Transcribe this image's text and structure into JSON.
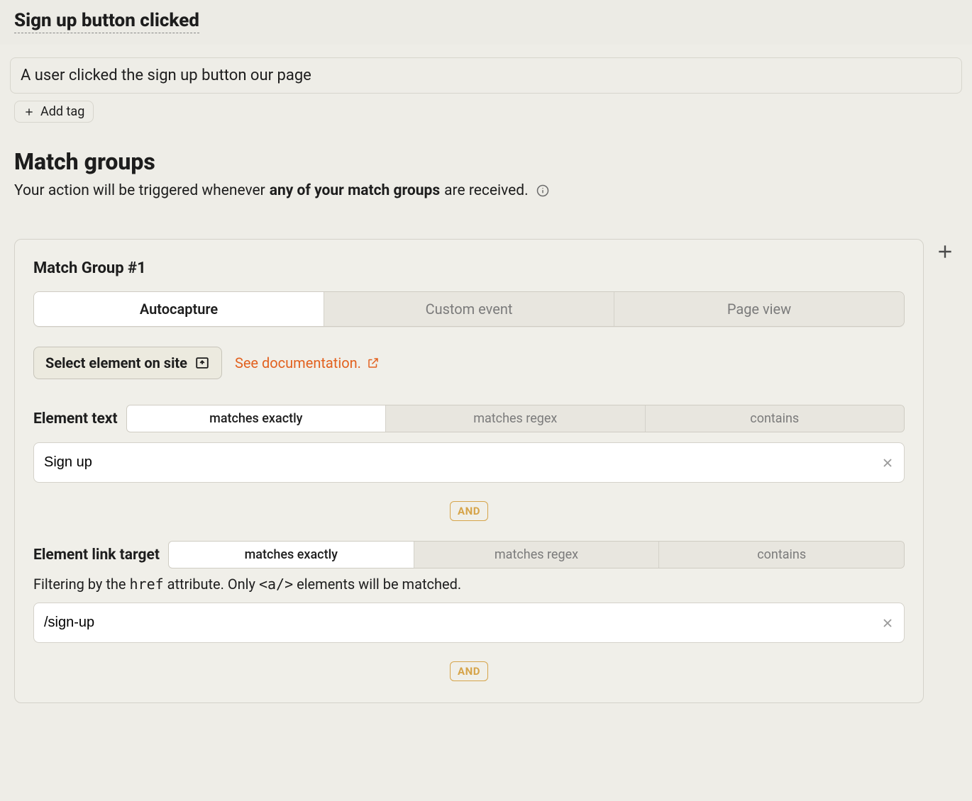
{
  "header": {
    "title": "Sign up button clicked"
  },
  "description": "A user clicked the sign up button our page",
  "tag_button": "Add tag",
  "match_groups_section": {
    "title": "Match groups",
    "subtitle_pre": "Your action will be triggered whenever ",
    "subtitle_bold": "any of your match groups",
    "subtitle_post": " are received."
  },
  "group": {
    "title": "Match Group #1",
    "type_tabs": [
      "Autocapture",
      "Custom event",
      "Page view"
    ],
    "type_selected": 0,
    "select_element": "Select element on site",
    "doc_link": "See documentation.",
    "element_text": {
      "label": "Element text",
      "options": [
        "matches exactly",
        "matches regex",
        "contains"
      ],
      "selected": 0,
      "value": "Sign up"
    },
    "and_label": "AND",
    "link_target": {
      "label": "Element link target",
      "options": [
        "matches exactly",
        "matches regex",
        "contains"
      ],
      "selected": 0,
      "help_pre": "Filtering by the ",
      "help_code1": "href",
      "help_mid": " attribute. Only ",
      "help_code2": "<a/>",
      "help_post": " elements will be matched.",
      "value": "/sign-up"
    }
  }
}
